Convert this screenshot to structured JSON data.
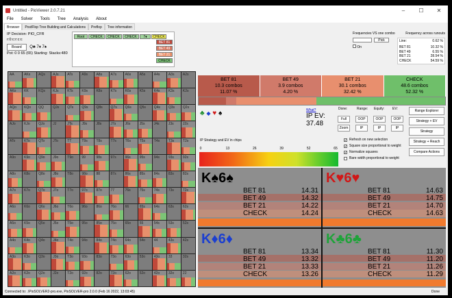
{
  "window": {
    "title": "Untitled - PioViewer 2.0.7.21",
    "controls": [
      "–",
      "☐",
      "✕"
    ]
  },
  "menu": [
    "File",
    "Solver",
    "Tools",
    "Tree",
    "Analysis",
    "About"
  ],
  "tabs": [
    "Browser",
    "PostFlop Tree Building and Calculations",
    "Preflop",
    "Tree information"
  ],
  "info": {
    "decision": "IP Decision:  PIO_CFR",
    "line": "r:0:c:r:c:c",
    "board_button": "Board",
    "board_cards": "Q♣ 7♦ 7♠",
    "pot": "Pot: 0 0 65 (65) Starting: Stacks:480"
  },
  "tree": {
    "root": "Root",
    "check1": "CHECK",
    "check2": "CHECK",
    "check3": "CHECK",
    "turn": "7♦",
    "check4": "CHECK",
    "bets": [
      "BET 81",
      "BET 49",
      "BET 21",
      "CHECK"
    ]
  },
  "right_top": {
    "freq_vs_one": "Frequencies VS one combo",
    "freq_across": "Frequency across runouts",
    "pick": "Pick",
    "on": "On",
    "line_label": "Line:",
    "line_val": "0.62 %",
    "freqs": [
      {
        "a": "BET 81",
        "v": "10.32 %"
      },
      {
        "a": "BET 49",
        "v": "6.55 %"
      },
      {
        "a": "BET 21",
        "v": "28.54 %"
      },
      {
        "a": "CHECK",
        "v": "54.59 %"
      }
    ]
  },
  "hands": [
    "AA",
    "AKs",
    "AQs",
    "AJs",
    "ATs",
    "A9s",
    "A8s",
    "A7s",
    "A6s",
    "A5s",
    "A4s",
    "A3s",
    "A2s",
    "AKo",
    "KK",
    "KQs",
    "KJs",
    "KTs",
    "K9s",
    "K8s",
    "K7s",
    "K6s",
    "K5s",
    "K4s",
    "K3s",
    "K2s",
    "AQo",
    "KQo",
    "QQ",
    "QJs",
    "QTs",
    "Q9s",
    "Q8s",
    "Q7s",
    "Q6s",
    "Q5s",
    "Q4s",
    "Q3s",
    "Q2s",
    "AJo",
    "KJo",
    "QJo",
    "JJ",
    "JTs",
    "J9s",
    "J8s",
    "J7s",
    "J6s",
    "J5s",
    "J4s",
    "J3s",
    "J2s",
    "ATo",
    "KTo",
    "QTo",
    "JTo",
    "TT",
    "T9s",
    "T8s",
    "T7s",
    "T6s",
    "T5s",
    "T4s",
    "T3s",
    "T2s",
    "A9o",
    "K9o",
    "Q9o",
    "J9o",
    "T9o",
    "99",
    "98s",
    "97s",
    "96s",
    "95s",
    "94s",
    "93s",
    "92s",
    "A8o",
    "K8o",
    "Q8o",
    "J8o",
    "T8o",
    "98o",
    "88",
    "87s",
    "86s",
    "85s",
    "84s",
    "83s",
    "82s",
    "A7o",
    "K7o",
    "Q7o",
    "J7o",
    "T7o",
    "97o",
    "87o",
    "77",
    "76s",
    "75s",
    "74s",
    "73s",
    "72s",
    "A6o",
    "K6o",
    "Q6o",
    "J6o",
    "T6o",
    "96o",
    "86o",
    "76o",
    "66",
    "65s",
    "64s",
    "63s",
    "62s",
    "A5o",
    "K5o",
    "Q5o",
    "J5o",
    "T5o",
    "95o",
    "85o",
    "75o",
    "65o",
    "55",
    "54s",
    "53s",
    "52s",
    "A4o",
    "K4o",
    "Q4o",
    "J4o",
    "T4o",
    "94o",
    "84o",
    "74o",
    "64o",
    "54o",
    "44",
    "43s",
    "42s",
    "A3o",
    "K3o",
    "Q3o",
    "J3o",
    "T3o",
    "93o",
    "83o",
    "73o",
    "63o",
    "53o",
    "43o",
    "33",
    "32s",
    "A2o",
    "K2o",
    "Q2o",
    "J2o",
    "T2o",
    "92o",
    "82o",
    "72o",
    "62o",
    "52o",
    "42o",
    "32o",
    "22"
  ],
  "actions": [
    {
      "name": "BET 81",
      "combos": "10.3 combos",
      "pct": "11.07 %",
      "share": 11.07,
      "color": "#b85a4b"
    },
    {
      "name": "BET 49",
      "combos": "3.9 combos",
      "pct": "4.20 %",
      "share": 4.2,
      "color": "#d07a6a"
    },
    {
      "name": "BET 21",
      "combos": "30.1 combos",
      "pct": "32.42 %",
      "share": 32.42,
      "color": "#e88f6e"
    },
    {
      "name": "CHECK",
      "combos": "48.6 combos",
      "pct": "52.32 %",
      "share": 52.32,
      "color": "#6fbf6a"
    }
  ],
  "suit_filter": [
    "♣",
    "◆",
    "♥",
    "♠"
  ],
  "ev": {
    "what": "What?",
    "label": "IP EV:",
    "value": "37.48"
  },
  "controls": {
    "headers": [
      "Done:",
      "Range:",
      "Equity:",
      "EV:"
    ],
    "full": "Full",
    "zoom": "Zoom",
    "oop": "OOP",
    "ip": "IP"
  },
  "right_buttons": [
    "Range Explorer",
    "Strategy + EV",
    "Strategy",
    "Strategy + Reach",
    "Compare Actions"
  ],
  "checkboxes": [
    {
      "label": "Refresh on new selection",
      "checked": true
    },
    {
      "label": "Square size proportional to weight",
      "checked": true
    },
    {
      "label": "Normalize squares",
      "checked": true
    },
    {
      "label": "Bare width proportional to weight",
      "checked": false
    }
  ],
  "chart_label": "IP Strategy and EV in chips",
  "chart_data": {
    "type": "heatmap",
    "title": "IP Strategy and EV in chips",
    "scale_ticks": [
      "0",
      "13",
      "26",
      "39",
      "52",
      "65"
    ],
    "range": [
      0,
      65
    ]
  },
  "combos": [
    {
      "card1": "K",
      "suit1": "♠",
      "card2": "6",
      "suit2": "♠",
      "color": "#000",
      "rows": [
        {
          "a": "BET 81",
          "v": "14.31"
        },
        {
          "a": "BET 49",
          "v": "14.32"
        },
        {
          "a": "BET 21",
          "v": "14.22"
        },
        {
          "a": "CHECK",
          "v": "14.24"
        }
      ]
    },
    {
      "card1": "K",
      "suit1": "♥",
      "card2": "6",
      "suit2": "♥",
      "color": "#d01818",
      "rows": [
        {
          "a": "BET 81",
          "v": "14.63"
        },
        {
          "a": "BET 49",
          "v": "14.75"
        },
        {
          "a": "BET 21",
          "v": "14.70"
        },
        {
          "a": "CHECK",
          "v": "14.63"
        }
      ]
    },
    {
      "card1": "K",
      "suit1": "♦",
      "card2": "6",
      "suit2": "♦",
      "color": "#1b3fd0",
      "rows": [
        {
          "a": "BET 81",
          "v": "13.34"
        },
        {
          "a": "BET 49",
          "v": "13.32"
        },
        {
          "a": "BET 21",
          "v": "13.33"
        },
        {
          "a": "CHECK",
          "v": "13.26"
        }
      ]
    },
    {
      "card1": "K",
      "suit1": "♣",
      "card2": "6",
      "suit2": "♣",
      "color": "#1fa33a",
      "rows": [
        {
          "a": "BET 81",
          "v": "11.30"
        },
        {
          "a": "BET 49",
          "v": "11.20"
        },
        {
          "a": "BET 21",
          "v": "11.26"
        },
        {
          "a": "CHECK",
          "v": "11.29"
        }
      ]
    }
  ],
  "status": {
    "left": "Connected to: .\\PioSOLVER2-pro.exe, PioSOLVER-pro 2.0.0 (Feb 16 2022, 13:03:45)",
    "right": "Done"
  }
}
